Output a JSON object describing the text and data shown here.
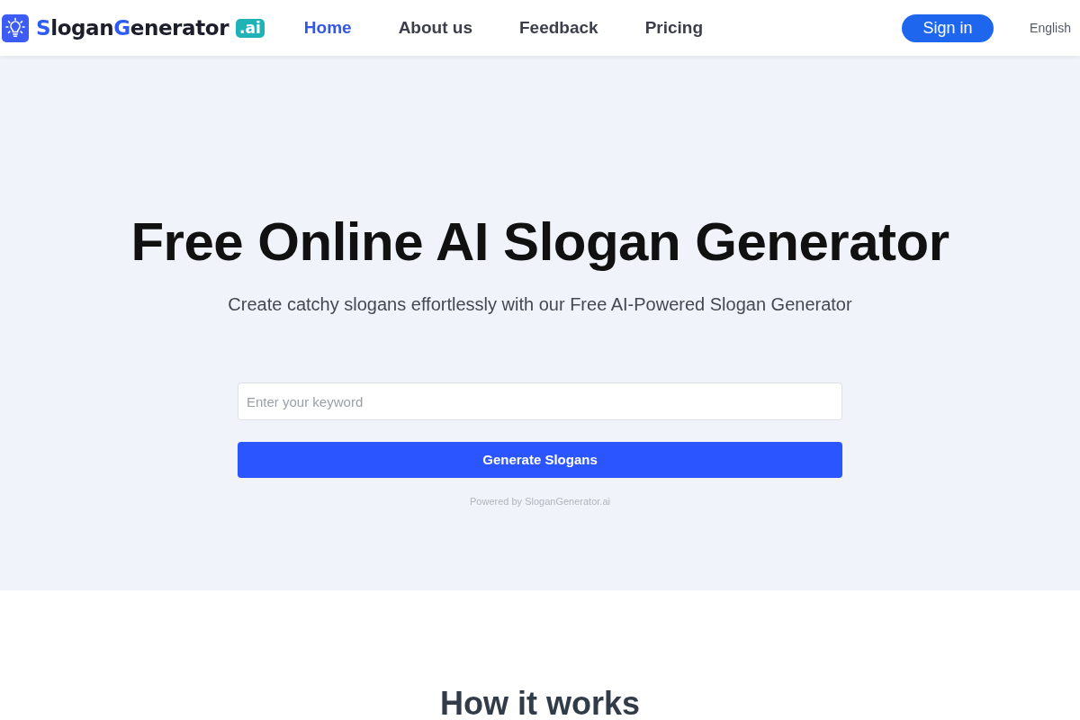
{
  "nav": {
    "logo": {
      "parts": [
        {
          "text": "S",
          "accent": true
        },
        {
          "text": "logan",
          "accent": false
        },
        {
          "text": "G",
          "accent": true
        },
        {
          "text": "enerator",
          "accent": false
        }
      ],
      "suffix": ".ai"
    },
    "links": [
      {
        "label": "Home",
        "selected": true
      },
      {
        "label": "About us",
        "selected": false
      },
      {
        "label": "Feedback",
        "selected": false
      },
      {
        "label": "Pricing",
        "selected": false
      }
    ],
    "sign_in": "Sign in",
    "language": "English"
  },
  "hero": {
    "title": "Free Online AI Slogan Generator",
    "subtitle": "Create catchy slogans effortlessly with our Free AI-Powered Slogan Generator",
    "keyword_field": {
      "placeholder": "Enter your keyword"
    },
    "button": "Generate Slogans",
    "footnote": "Powered by SloganGenerator.ai"
  },
  "section": {
    "heading": "How it works"
  }
}
